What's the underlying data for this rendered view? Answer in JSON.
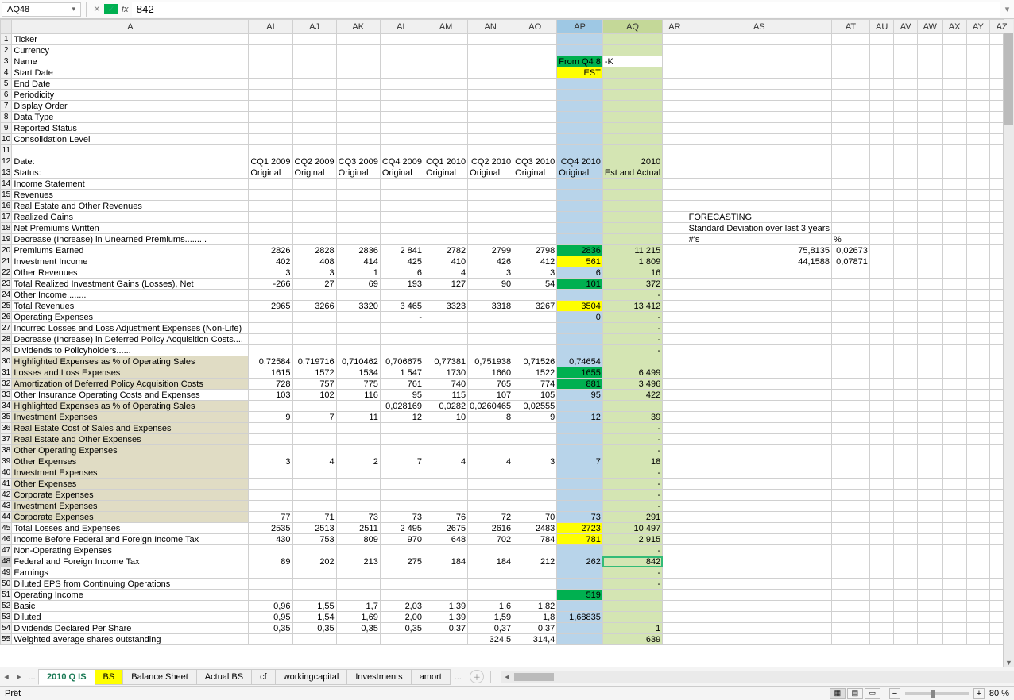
{
  "formula_bar": {
    "name_box": "AQ48",
    "formula": "842"
  },
  "sheet_tabs": {
    "ellipsis": "...",
    "active": "2010 Q IS",
    "yellow": "BS",
    "tabs": [
      "Balance Sheet",
      "Actual BS",
      "cf",
      "workingcapital",
      "Investments",
      "amort"
    ],
    "more": "..."
  },
  "status": {
    "ready": "Prêt",
    "zoom": "80 %"
  },
  "columns": [
    "A",
    "AI",
    "AJ",
    "AK",
    "AL",
    "AM",
    "AN",
    "AO",
    "AP",
    "AQ",
    "AR",
    "AS",
    "AT",
    "AU",
    "AV",
    "AW",
    "AX",
    "AY",
    "AZ"
  ],
  "rows": [
    {
      "n": 1,
      "A": "Ticker"
    },
    {
      "n": 2,
      "A": "Currency"
    },
    {
      "n": 3,
      "A": "Name",
      "AP": "From Q4 8",
      "AP_cls": "green",
      "AQ": "-K",
      "AQ_cls": ""
    },
    {
      "n": 4,
      "A": "Start Date",
      "AP": "EST",
      "AP_cls": "yellow"
    },
    {
      "n": 5,
      "A": "End Date"
    },
    {
      "n": 6,
      "A": "Periodicity"
    },
    {
      "n": 7,
      "A": "Display Order"
    },
    {
      "n": 8,
      "A": "Data Type"
    },
    {
      "n": 9,
      "A": "Reported Status"
    },
    {
      "n": 10,
      "A": "Consolidation Level"
    },
    {
      "n": 11,
      "A": ""
    },
    {
      "n": 12,
      "A": "Date:",
      "AI": "CQ1 2009",
      "AJ": "CQ2 2009",
      "AK": "CQ3 2009",
      "AL": "CQ4 2009",
      "AM": "CQ1 2010",
      "AN": "CQ2 2010",
      "AO": "CQ3 2010",
      "AP": "CQ4 2010",
      "AQ": "2010"
    },
    {
      "n": 13,
      "A": "Status:",
      "AI": "Original",
      "AJ": "Original",
      "AK": "Original",
      "AL": "Original",
      "AM": "Original",
      "AN": "Original",
      "AO": "Original",
      "AP": "Original",
      "AQ": "Est and Actual",
      "AI_left": true
    },
    {
      "n": 14,
      "A": "Income Statement"
    },
    {
      "n": 15,
      "A": "Revenues"
    },
    {
      "n": 16,
      "A": "Real Estate and Other Revenues"
    },
    {
      "n": 17,
      "A": "Realized Gains",
      "AS": "FORECASTING",
      "AS_left": true
    },
    {
      "n": 18,
      "A": "Net Premiums Written",
      "AS": "Standard Deviation over last 3 years",
      "AS_left": true
    },
    {
      "n": 19,
      "A": "Decrease (Increase) in         Unearned Premiums.........",
      "AS": "#'s",
      "AS_left": true,
      "AT": "%",
      "AT_left": true
    },
    {
      "n": 20,
      "A": "Premiums Earned",
      "AI": "2826",
      "AJ": "2828",
      "AK": "2836",
      "AL": "2 841",
      "AM": "2782",
      "AN": "2799",
      "AO": "2798",
      "AP": "2836",
      "AP_cls": "green",
      "AQ": "11 215",
      "AS": "75,8135",
      "AT": "0,02673"
    },
    {
      "n": 21,
      "A": "Investment Income",
      "AI": "402",
      "AJ": "408",
      "AK": "414",
      "AL": "425",
      "AM": "410",
      "AN": "426",
      "AO": "412",
      "AP": "561",
      "AP_cls": "yellow",
      "AQ": "1 809",
      "AS": "44,1588",
      "AT": "0,07871"
    },
    {
      "n": 22,
      "A": "Other Revenues",
      "AI": "3",
      "AJ": "3",
      "AK": "1",
      "AL": "6",
      "AM": "4",
      "AN": "3",
      "AO": "3",
      "AP": "6",
      "AQ": "16"
    },
    {
      "n": 23,
      "A": "Total Realized Investment Gains (Losses), Net",
      "AI": "-266",
      "AJ": "27",
      "AK": "69",
      "AL": "193",
      "AM": "127",
      "AN": "90",
      "AO": "54",
      "AP": "101",
      "AP_cls": "green",
      "AQ": "372"
    },
    {
      "n": 24,
      "A": "Other Income........",
      "AQ": "-"
    },
    {
      "n": 25,
      "A": "Total Revenues",
      "AI": "2965",
      "AJ": "3266",
      "AK": "3320",
      "AL": "3 465",
      "AM": "3323",
      "AN": "3318",
      "AO": "3267",
      "AP": "3504",
      "AP_cls": "yellow",
      "AQ": "13 412"
    },
    {
      "n": 26,
      "A": "Operating Expenses",
      "AL": "-",
      "AP": "0",
      "AQ": "-"
    },
    {
      "n": 27,
      "A": "Incurred Losses and Loss Adjustment Expenses (Non-Life)",
      "AQ": "-"
    },
    {
      "n": 28,
      "A": "Decrease (Increase) in Deferred        Policy Acquisition Costs....",
      "AQ": "-"
    },
    {
      "n": 29,
      "A": "Dividends to Policyholders......",
      "AQ": "-"
    },
    {
      "n": 30,
      "A": "Highlighted Expenses as % of Operating Sales",
      "A_cls": "tan",
      "AI": "0,72584",
      "AJ": "0,719716",
      "AK": "0,710462",
      "AL": "0,706675",
      "AM": "0,77381",
      "AN": "0,751938",
      "AO": "0,71526",
      "AP": "0,74654"
    },
    {
      "n": 31,
      "A": "Losses and Loss Expenses",
      "A_cls": "tan",
      "AI": "1615",
      "AJ": "1572",
      "AK": "1534",
      "AL": "1 547",
      "AM": "1730",
      "AN": "1660",
      "AO": "1522",
      "AP": "1655",
      "AP_cls": "green",
      "AQ": "6 499"
    },
    {
      "n": 32,
      "A": "Amortization of Deferred Policy Acquisition Costs",
      "A_cls": "tan",
      "AI": "728",
      "AJ": "757",
      "AK": "775",
      "AL": "761",
      "AM": "740",
      "AN": "765",
      "AO": "774",
      "AP": "881",
      "AP_cls": "green",
      "AQ": "3 496"
    },
    {
      "n": 33,
      "A": "Other Insurance Operating Costs and Expenses",
      "AI": "103",
      "AJ": "102",
      "AK": "116",
      "AL": "95",
      "AM": "115",
      "AN": "107",
      "AO": "105",
      "AP": "95",
      "AQ": "422"
    },
    {
      "n": 34,
      "A": "Highlighted Expenses as % of Operating Sales",
      "A_cls": "tan",
      "AL": "0,028169",
      "AM": "0,0282",
      "AN": "0,0260465",
      "AO": "0,02555"
    },
    {
      "n": 35,
      "A": "Investment Expenses",
      "A_cls": "tan",
      "AI": "9",
      "AJ": "7",
      "AK": "11",
      "AL": "12",
      "AM": "10",
      "AN": "8",
      "AO": "9",
      "AP": "12",
      "AQ": "39"
    },
    {
      "n": 36,
      "A": "Real Estate Cost of Sales and Expenses",
      "A_cls": "tan",
      "AQ": "-"
    },
    {
      "n": 37,
      "A": "Real Estate and Other Expenses",
      "A_cls": "tan",
      "AQ": "-"
    },
    {
      "n": 38,
      "A": "Other Operating Expenses",
      "A_cls": "tan",
      "AQ": "-"
    },
    {
      "n": 39,
      "A": "Other Expenses",
      "A_cls": "tan",
      "AI": "3",
      "AJ": "4",
      "AK": "2",
      "AL": "7",
      "AM": "4",
      "AN": "4",
      "AO": "3",
      "AP": "7",
      "AQ": "18"
    },
    {
      "n": 40,
      "A": "Investment Expenses",
      "A_cls": "tan",
      "AQ": "-"
    },
    {
      "n": 41,
      "A": "Other Expenses",
      "A_cls": "tan",
      "AQ": "-"
    },
    {
      "n": 42,
      "A": "Corporate Expenses",
      "A_cls": "tan",
      "AQ": "-"
    },
    {
      "n": 43,
      "A": "Investment Expenses",
      "A_cls": "tan",
      "AQ": "-"
    },
    {
      "n": 44,
      "A": "Corporate Expenses",
      "A_cls": "tan",
      "AI": "77",
      "AJ": "71",
      "AK": "73",
      "AL": "73",
      "AM": "76",
      "AN": "72",
      "AO": "70",
      "AP": "73",
      "AQ": "291"
    },
    {
      "n": 45,
      "A": "Total Losses and Expenses",
      "AI": "2535",
      "AJ": "2513",
      "AK": "2511",
      "AL": "2 495",
      "AM": "2675",
      "AN": "2616",
      "AO": "2483",
      "AP": "2723",
      "AP_cls": "yellow",
      "AQ": "10 497"
    },
    {
      "n": 46,
      "A": "Income Before Federal and Foreign Income Tax",
      "AI": "430",
      "AJ": "753",
      "AK": "809",
      "AL": "970",
      "AM": "648",
      "AN": "702",
      "AO": "784",
      "AP": "781",
      "AP_cls": "yellow",
      "AQ": "2 915"
    },
    {
      "n": 47,
      "A": "Non-Operating Expenses",
      "AQ": "-"
    },
    {
      "n": 48,
      "A": "Federal and Foreign Income Tax",
      "AI": "89",
      "AJ": "202",
      "AK": "213",
      "AL": "275",
      "AM": "184",
      "AN": "184",
      "AO": "212",
      "AP": "262",
      "AQ": "842",
      "AQ_sel": true
    },
    {
      "n": 49,
      "A": "Earnings",
      "AQ": "-"
    },
    {
      "n": 50,
      "A": "Diluted EPS from Continuing Operations",
      "AQ": "-"
    },
    {
      "n": 51,
      "A": "Operating Income",
      "AP": "519",
      "AP_cls": "green"
    },
    {
      "n": 52,
      "A": "Basic",
      "AI": "0,96",
      "AJ": "1,55",
      "AK": "1,7",
      "AL": "2,03",
      "AM": "1,39",
      "AN": "1,6",
      "AO": "1,82"
    },
    {
      "n": 53,
      "A": "Diluted",
      "AI": "0,95",
      "AJ": "1,54",
      "AK": "1,69",
      "AL": "2,00",
      "AM": "1,39",
      "AN": "1,59",
      "AO": "1,8",
      "AP": "1,68835"
    },
    {
      "n": 54,
      "A": "Dividends Declared Per Share",
      "AI": "0,35",
      "AJ": "0,35",
      "AK": "0,35",
      "AL": "0,35",
      "AM": "0,37",
      "AN": "0,37",
      "AO": "0,37",
      "AQ": "1"
    },
    {
      "n": 55,
      "A": "Weighted average shares outstanding",
      "AN": "324,5",
      "AO": "314,4",
      "AQ": "639"
    }
  ]
}
